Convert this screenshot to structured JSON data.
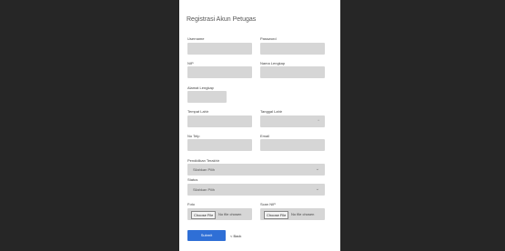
{
  "form": {
    "title": "Registrasi Akun Petugas",
    "fields": {
      "username": "Username",
      "password": "Password",
      "nip": "NIP",
      "nama_lengkap": "Nama Lengkap",
      "alamat": "Alamat Lengkap",
      "tempat_lahir": "Tempat Lahir",
      "tanggal_lahir": "Tanggal Lahir",
      "no_telp": "No Telp",
      "email": "Email",
      "pendidikan": "Pendidikan Terakhir",
      "status": "Status",
      "foto": "Foto",
      "scan_nip": "Scan NIP"
    },
    "select_placeholder": "Silahkan Pilih",
    "choose_file": "Choose File",
    "no_file": "No file chosen",
    "submit_label": "Submit",
    "back_label": "< Back"
  }
}
